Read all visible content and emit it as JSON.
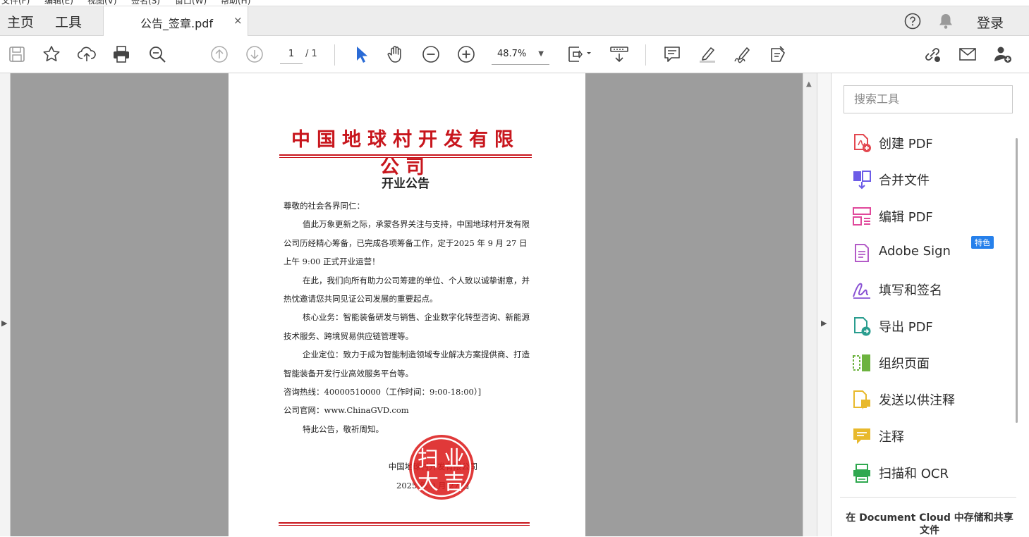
{
  "menubar": [
    "文件(F)",
    "编辑(E)",
    "视图(V)",
    "签名(S)",
    "窗口(W)",
    "帮助(H)"
  ],
  "tabs": {
    "home": "主页",
    "tools": "工具",
    "document": "公告_签章.pdf",
    "close": "×"
  },
  "header": {
    "login": "登录"
  },
  "toolbar": {
    "page_current": "1",
    "page_total": "/ 1",
    "zoom": "48.7%",
    "zoom_arrow": "▼"
  },
  "document": {
    "company": "中国地球村开发有限公司",
    "title": "开业公告",
    "paragraphs": [
      "尊敬的社会各界同仁：",
      "值此万象更新之际，承蒙各界关注与支持，中国地球村开发有限公司历经精心筹备，已完成各项筹备工作，定于2025 年 9 月 27 日上午 9:00 正式开业运营！",
      "在此，我们向所有助力公司筹建的单位、个人致以诚挚谢意，并热忱邀请您共同见证公司发展的重要起点。",
      "核心业务：智能装备研发与销售、企业数字化转型咨询、新能源技术服务、跨境贸易供应链管理等。",
      "企业定位：致力于成为智能制造领域专业解决方案提供商、打造智能装备开发行业高效服务平台等。",
      "咨询热线：40000510000（工作时间：9:00-18:00）]",
      "公司官网：www.ChinaGVD.com",
      "特此公告，敬祈周知。"
    ],
    "signature_company": "中国地球村开发有限公司",
    "signature_date": "2025 年 9 月 27 日",
    "seal_text": [
      "扫",
      "业",
      "大",
      "吉"
    ]
  },
  "tools_panel": {
    "search_placeholder": "搜索工具",
    "items": [
      {
        "label": "创建 PDF",
        "icon": "create-pdf-icon",
        "color": "#e34850"
      },
      {
        "label": "合并文件",
        "icon": "combine-files-icon",
        "color": "#6c5ce7"
      },
      {
        "label": "编辑 PDF",
        "icon": "edit-pdf-icon",
        "color": "#e0489b"
      },
      {
        "label": "Adobe Sign",
        "icon": "adobe-sign-icon",
        "color": "#b35bc8"
      },
      {
        "label": "填写和签名",
        "icon": "fill-sign-icon",
        "color": "#8a52d4"
      },
      {
        "label": "导出 PDF",
        "icon": "export-pdf-icon",
        "color": "#2a9d8f"
      },
      {
        "label": "组织页面",
        "icon": "organize-pages-icon",
        "color": "#6db33f"
      },
      {
        "label": "发送以供注释",
        "icon": "send-for-comments-icon",
        "color": "#e8b92c"
      },
      {
        "label": "注释",
        "icon": "comment-icon",
        "color": "#e8b92c"
      },
      {
        "label": "扫描和 OCR",
        "icon": "scan-ocr-icon",
        "color": "#2fa84f"
      }
    ],
    "badge": "特色",
    "promo": "在 Document Cloud 中存储和共享文件"
  }
}
